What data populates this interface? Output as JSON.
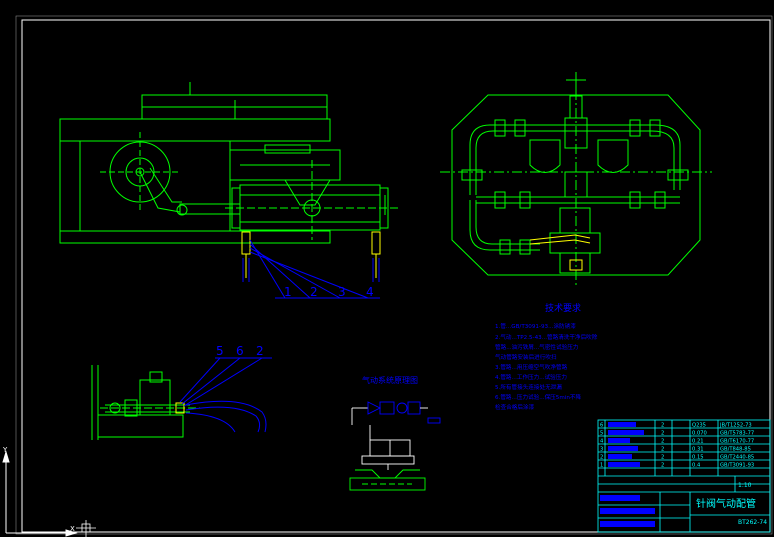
{
  "colors": {
    "background": "#000000",
    "frame": "#ffffff",
    "outline": "#00ff00",
    "leader": "#0000ff",
    "fitting": "#ffff00",
    "note_text": "#0000ff",
    "table_line": "#00ffff",
    "table_text": "#00ffff"
  },
  "icons": {
    "ucs": "ucs-axis-icon",
    "cursor": "crosshair-cursor-icon"
  },
  "front_view": {
    "callouts": [
      "1",
      "2",
      "3",
      "4"
    ]
  },
  "detail_view": {
    "callouts": [
      "5",
      "6",
      "2"
    ]
  },
  "schematic": {
    "title": "气动系统原理图"
  },
  "tech_notes": {
    "title": "技术要求",
    "lines": [
      "1.管...GB/T3091-93...涂防锈漆",
      "2.气动...TP2.5-43...管路清洗干净后吹除",
      "  管路...油污铁屑...气密性试验压力",
      "  气动管路安装后进行吹扫",
      "3.管路...用压缩空气吹净管路",
      "4.管路...工作压力...试验压力",
      "5.所有管接头连接处无泄漏",
      "6.管路...压力试验...保压5min不降",
      "  检查合格后涂漆"
    ]
  },
  "title_block": {
    "drawing_title": "针阀气动配管",
    "drawing_number": "BT262-74",
    "scale": "1:10",
    "rows": [
      {
        "no": "6",
        "qty": "2",
        "mat": "Q235",
        "std": "JB/T1252-73"
      },
      {
        "no": "5",
        "qty": "2",
        "mat": "0.070",
        "std": "GB/T5783-77"
      },
      {
        "no": "4",
        "qty": "2",
        "mat": "0.21",
        "std": "GB/T6170-77"
      },
      {
        "no": "3",
        "qty": "2",
        "mat": "0.31",
        "std": "GB/T848-85"
      },
      {
        "no": "2",
        "qty": "2",
        "mat": "0.15",
        "std": "GB/T2440-85"
      },
      {
        "no": "1",
        "qty": "2",
        "mat": "0.4",
        "std": "GB/T3091-93"
      }
    ]
  }
}
